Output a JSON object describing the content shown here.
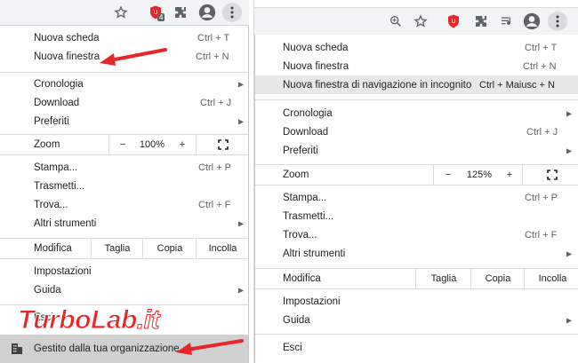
{
  "left": {
    "menu": {
      "new_tab": {
        "label": "Nuova scheda",
        "shortcut": "Ctrl + T"
      },
      "new_window": {
        "label": "Nuova finestra",
        "shortcut": "Ctrl + N"
      },
      "history": {
        "label": "Cronologia"
      },
      "downloads": {
        "label": "Download",
        "shortcut": "Ctrl + J"
      },
      "bookmarks": {
        "label": "Preferiti"
      },
      "zoom": {
        "label": "Zoom",
        "minus": "−",
        "value": "100%",
        "plus": "+"
      },
      "print": {
        "label": "Stampa...",
        "shortcut": "Ctrl + P"
      },
      "cast": {
        "label": "Trasmetti..."
      },
      "find": {
        "label": "Trova...",
        "shortcut": "Ctrl + F"
      },
      "more_tools": {
        "label": "Altri strumenti"
      },
      "edit": {
        "label": "Modifica",
        "cut": "Taglia",
        "copy": "Copia",
        "paste": "Incolla"
      },
      "settings": {
        "label": "Impostazioni"
      },
      "help": {
        "label": "Guida"
      },
      "exit": {
        "label": "Esci"
      },
      "managed": {
        "label": "Gestito dalla tua organizzazione"
      }
    },
    "extension_badge": "4"
  },
  "right": {
    "menu": {
      "new_tab": {
        "label": "Nuova scheda",
        "shortcut": "Ctrl + T"
      },
      "new_window": {
        "label": "Nuova finestra",
        "shortcut": "Ctrl + N"
      },
      "incognito": {
        "label": "Nuova finestra di navigazione in incognito",
        "shortcut": "Ctrl + Maiusc + N"
      },
      "history": {
        "label": "Cronologia"
      },
      "downloads": {
        "label": "Download",
        "shortcut": "Ctrl + J"
      },
      "bookmarks": {
        "label": "Preferiti"
      },
      "zoom": {
        "label": "Zoom",
        "minus": "−",
        "value": "125%",
        "plus": "+"
      },
      "print": {
        "label": "Stampa...",
        "shortcut": "Ctrl + P"
      },
      "cast": {
        "label": "Trasmetti..."
      },
      "find": {
        "label": "Trova...",
        "shortcut": "Ctrl + F"
      },
      "more_tools": {
        "label": "Altri strumenti"
      },
      "edit": {
        "label": "Modifica",
        "cut": "Taglia",
        "copy": "Copia",
        "paste": "Incolla"
      },
      "settings": {
        "label": "Impostazioni"
      },
      "help": {
        "label": "Guida"
      },
      "exit": {
        "label": "Esci"
      }
    }
  },
  "watermark": {
    "part1": "Turbo",
    "part2": "Lab",
    "part3": ".it"
  },
  "icons": {
    "star": "star-icon",
    "shield": "shield-extension-icon",
    "puzzle": "extensions-icon",
    "profile": "profile-icon",
    "kebab": "more-vert-icon",
    "zoom_glass": "zoom-search-icon",
    "reading_list": "reading-list-icon",
    "fullscreen": "fullscreen-icon",
    "managed": "building-icon",
    "arrow": "red-arrow-icon"
  },
  "colors": {
    "accent_red": "#e8262a",
    "highlight": "#e8e8e8",
    "managed_bg": "#d0d0d0"
  }
}
